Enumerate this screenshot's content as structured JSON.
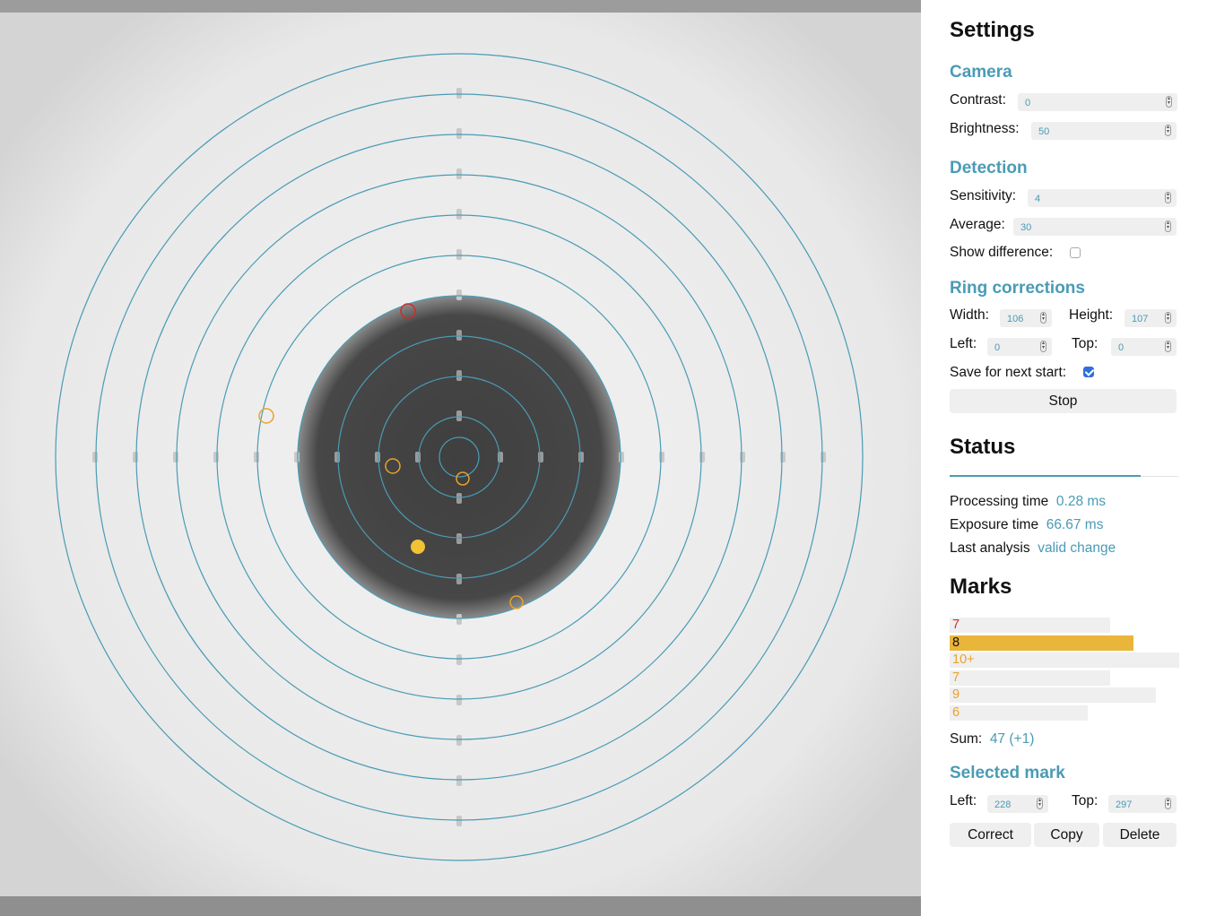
{
  "settings": {
    "title": "Settings",
    "camera": {
      "heading": "Camera",
      "contrast_label": "Contrast:",
      "contrast_value": "0",
      "brightness_label": "Brightness:",
      "brightness_value": "50"
    },
    "detection": {
      "heading": "Detection",
      "sensitivity_label": "Sensitivity:",
      "sensitivity_value": "4",
      "average_label": "Average:",
      "average_value": "30",
      "show_difference_label": "Show difference:",
      "show_difference_checked": false
    },
    "ring_corrections": {
      "heading": "Ring corrections",
      "width_label": "Width:",
      "width_value": "106",
      "height_label": "Height:",
      "height_value": "107",
      "left_label": "Left:",
      "left_value": "0",
      "top_label": "Top:",
      "top_value": "0",
      "save_label": "Save for next start:",
      "save_checked": true
    },
    "stop_button": "Stop"
  },
  "status": {
    "title": "Status",
    "processing_label": "Processing time",
    "processing_value": "0.28 ms",
    "exposure_label": "Exposure time",
    "exposure_value": "66.67 ms",
    "analysis_label": "Last analysis",
    "analysis_value": "valid change"
  },
  "marks": {
    "title": "Marks",
    "items": [
      {
        "score": "7",
        "color": "#d42a2a",
        "selected": false
      },
      {
        "score": "8",
        "color": "#111111",
        "selected": true
      },
      {
        "score": "10+",
        "color": "#e9a22b",
        "selected": false
      },
      {
        "score": "7",
        "color": "#e9a22b",
        "selected": false
      },
      {
        "score": "9",
        "color": "#e9a22b",
        "selected": false
      },
      {
        "score": "6",
        "color": "#e9a22b",
        "selected": false
      }
    ],
    "sum_label": "Sum:",
    "sum_value": "47 (+1)"
  },
  "selected_mark": {
    "heading": "Selected mark",
    "left_label": "Left:",
    "left_value": "228",
    "top_label": "Top:",
    "top_value": "297",
    "correct_button": "Correct",
    "copy_button": "Copy",
    "delete_button": "Delete"
  },
  "colors": {
    "accent": "#4a9bb5",
    "ring": "#4a9bb5",
    "mark_selected": "#e9b53a",
    "mark_red": "#d42a2a",
    "mark_yellow": "#e9a22b"
  }
}
